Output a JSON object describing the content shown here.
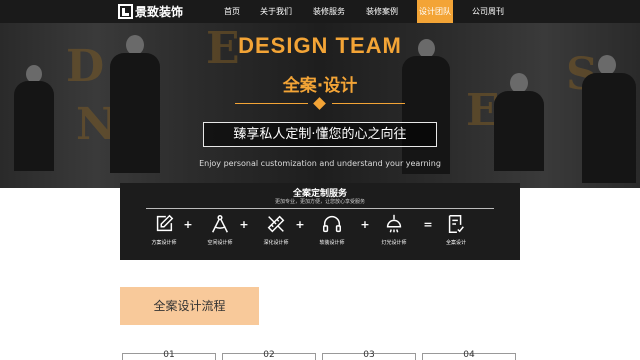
{
  "brand": {
    "name": "景致装饰"
  },
  "nav": {
    "items": [
      {
        "label": "首页",
        "active": false
      },
      {
        "label": "关于我们",
        "active": false
      },
      {
        "label": "装修服务",
        "active": false
      },
      {
        "label": "装修案例",
        "active": false
      },
      {
        "label": "设计团队",
        "active": true
      },
      {
        "label": "公司周刊",
        "active": false
      }
    ]
  },
  "hero": {
    "title": "DESIGN TEAM",
    "subtitle": "全案·设计",
    "slogan": "臻享私人定制·懂您的心之向往",
    "slogan_en": "Enjoy personal customization and understand your yearning",
    "decorative_letters": [
      "D",
      "N",
      "E",
      "E",
      "S"
    ]
  },
  "service": {
    "title": "全案定制服务",
    "description": "更加专业，更加方便，让您放心享受服务",
    "items": [
      {
        "label": "方案设计师",
        "icon": "pen-edit-icon"
      },
      {
        "label": "空间设计师",
        "icon": "drafting-compass-icon"
      },
      {
        "label": "深化设计师",
        "icon": "ruler-pencil-icon"
      },
      {
        "label": "软装设计师",
        "icon": "headset-icon"
      },
      {
        "label": "灯光设计师",
        "icon": "pendant-lamp-icon"
      },
      {
        "label": "全案设计",
        "icon": "checklist-icon"
      }
    ],
    "operators": [
      "+",
      "+",
      "+",
      "+",
      "="
    ]
  },
  "process": {
    "title": "全案设计流程"
  },
  "steps": [
    "01",
    "02",
    "03",
    "04"
  ],
  "colors": {
    "accent": "#f3a436",
    "nav_bg": "#1a1a1a",
    "panel_bg": "#1c1c1c",
    "process_bg": "#f8c99a"
  }
}
